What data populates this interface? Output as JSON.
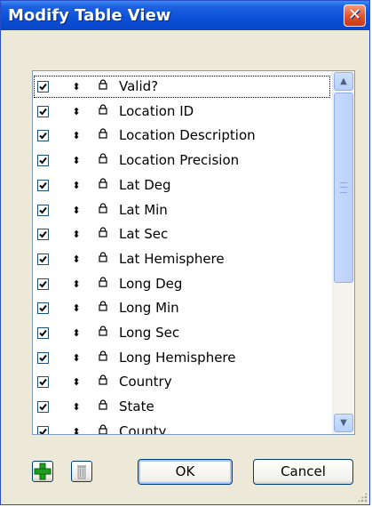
{
  "window": {
    "title": "Modify Table View",
    "close_label": "✕"
  },
  "fields": [
    {
      "label": "Valid?",
      "checked": true
    },
    {
      "label": "Location ID",
      "checked": true
    },
    {
      "label": "Location Description",
      "checked": true
    },
    {
      "label": "Location Precision",
      "checked": true
    },
    {
      "label": "Lat Deg",
      "checked": true
    },
    {
      "label": "Lat Min",
      "checked": true
    },
    {
      "label": "Lat Sec",
      "checked": true
    },
    {
      "label": "Lat Hemisphere",
      "checked": true
    },
    {
      "label": "Long Deg",
      "checked": true
    },
    {
      "label": "Long Min",
      "checked": true
    },
    {
      "label": "Long Sec",
      "checked": true
    },
    {
      "label": "Long Hemisphere",
      "checked": true
    },
    {
      "label": "Country",
      "checked": true
    },
    {
      "label": "State",
      "checked": true
    },
    {
      "label": "County",
      "checked": true
    }
  ],
  "buttons": {
    "ok": "OK",
    "cancel": "Cancel"
  },
  "icons": {
    "add": "plus-icon",
    "delete": "trash-icon",
    "drag": "drag-handle-icon",
    "lock": "lock-icon"
  },
  "colors": {
    "title_bar": "#0a4fd8",
    "add_green": "#1ea01e"
  }
}
